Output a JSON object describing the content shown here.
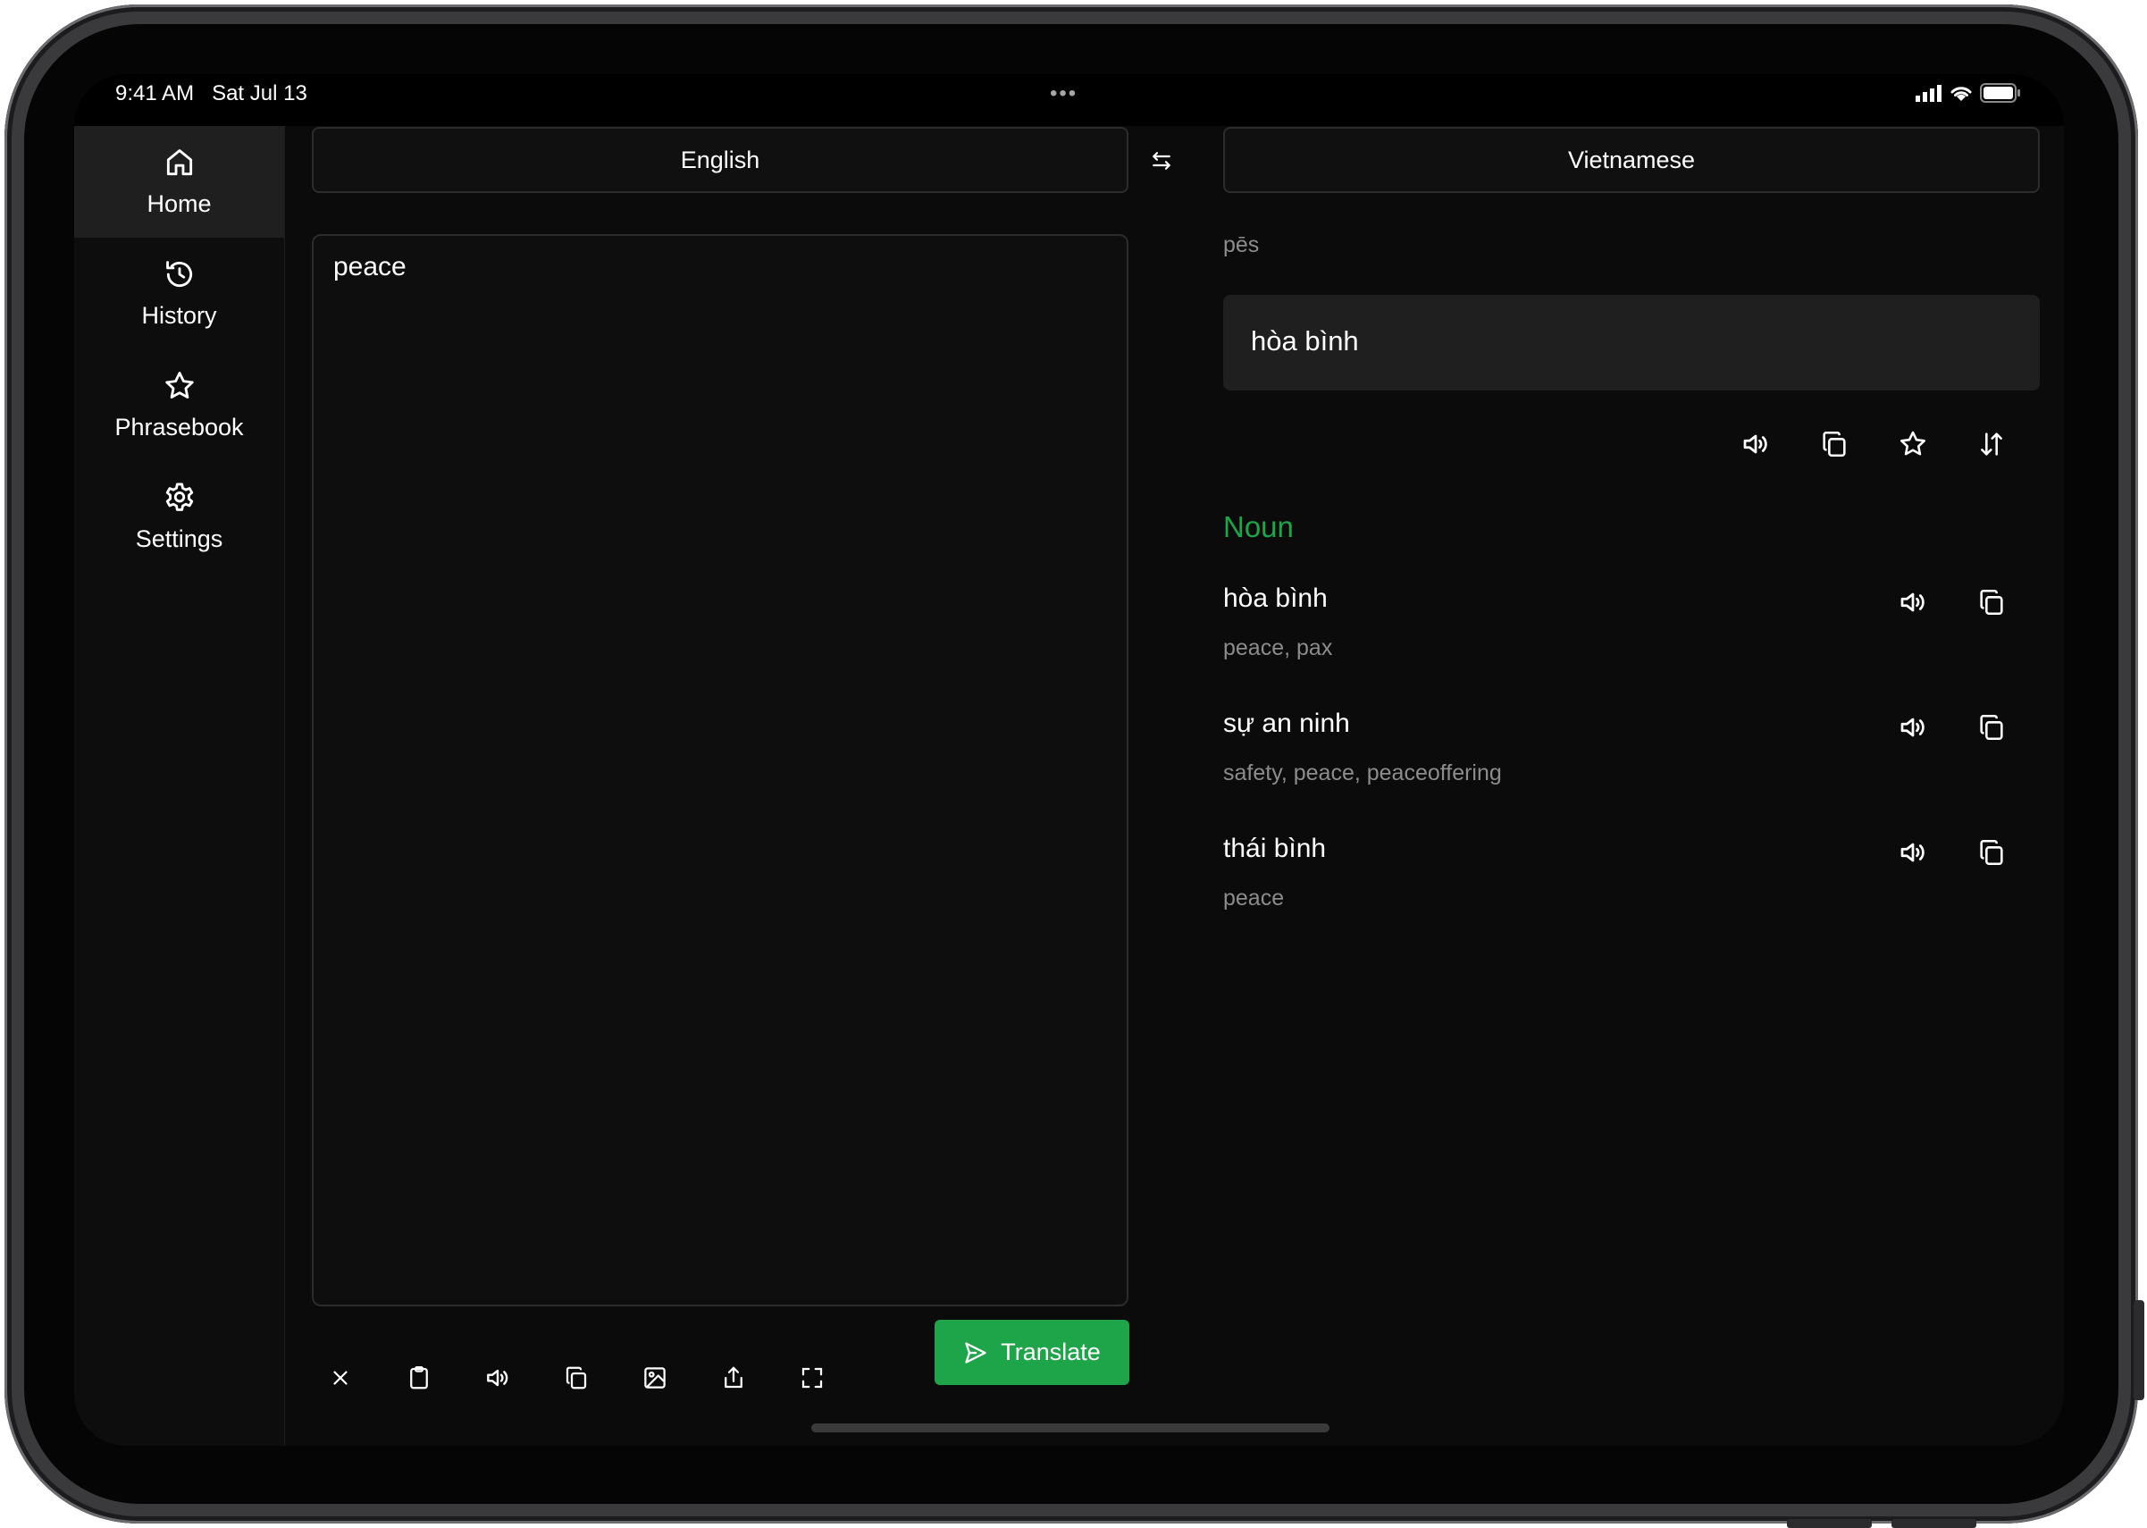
{
  "status_bar": {
    "time": "9:41 AM",
    "date": "Sat Jul 13",
    "dots": "•••"
  },
  "sidebar": {
    "items": [
      {
        "label": "Home",
        "icon": "home-icon",
        "active": true
      },
      {
        "label": "History",
        "icon": "history-icon",
        "active": false
      },
      {
        "label": "Phrasebook",
        "icon": "star-icon",
        "active": false
      },
      {
        "label": "Settings",
        "icon": "gear-icon",
        "active": false
      }
    ]
  },
  "languages": {
    "source": "English",
    "target": "Vietnamese"
  },
  "input": {
    "text": "peace"
  },
  "toolbar": {
    "icons": [
      "close-icon",
      "clipboard-icon",
      "speaker-icon",
      "copy-icon",
      "image-icon",
      "share-icon",
      "expand-icon"
    ],
    "translate_label": "Translate"
  },
  "result": {
    "phonetic": "pēs",
    "translation": "hòa bình"
  },
  "dictionary": {
    "part_of_speech": "Noun",
    "entries": [
      {
        "word": "hòa bình",
        "synonyms": "peace, pax"
      },
      {
        "word": "sự an ninh",
        "synonyms": "safety, peace, peaceoffering"
      },
      {
        "word": "thái bình",
        "synonyms": "peace"
      }
    ]
  },
  "colors": {
    "accent": "#1fa549",
    "background": "#0b0b0b",
    "sidebar_active": "#1f1f1f"
  }
}
